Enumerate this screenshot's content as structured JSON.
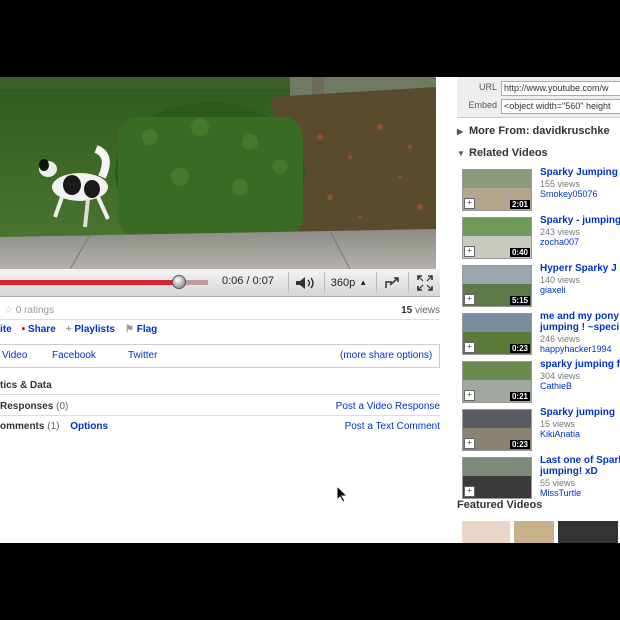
{
  "player": {
    "time": "0:06 / 0:07",
    "quality": "360p",
    "progress_fraction": 0.86,
    "buffered_fraction": 1.0
  },
  "info": {
    "ratings": "0 ratings",
    "views_count": "15",
    "views_label": "views"
  },
  "actions": {
    "favorite": "ite",
    "share": "Share",
    "playlists": "Playlists",
    "flag": "Flag"
  },
  "share_options": {
    "video": "Video",
    "facebook": "Facebook",
    "twitter": "Twitter",
    "more": "(more share options)"
  },
  "sections": {
    "stats": "tics & Data",
    "responses_label": "Responses",
    "responses_count": "(0)",
    "post_response": "Post a Video Response",
    "comments_label": "omments",
    "comments_count": "(1)",
    "options": "Options",
    "post_comment": "Post a Text Comment"
  },
  "embed": {
    "url_label": "URL",
    "url_value": "http://www.youtube.com/w",
    "embed_label": "Embed",
    "embed_value": "<object width=\"560\" height"
  },
  "sidebar": {
    "more_from": "More From: davidkruschke",
    "related_title": "Related Videos",
    "featured_title": "Featured Videos",
    "related": [
      {
        "title": "Sparky Jumping",
        "views": "155 views",
        "user": "Smokey05076",
        "duration": "2:01"
      },
      {
        "title": "Sparky - jumping",
        "views": "243 views",
        "user": "zocha007",
        "duration": "0:40"
      },
      {
        "title": "Hyperr Sparky J",
        "views": "140 views",
        "user": "giaxeli",
        "duration": "5:15"
      },
      {
        "title": "me and my pony",
        "title2": "jumping ! ~speci",
        "views": "246 views",
        "user": "happyhacker1994",
        "duration": "0:23"
      },
      {
        "title": "sparky jumping fr",
        "views": "304 views",
        "user": "CathieB",
        "duration": "0:21"
      },
      {
        "title": "Sparky jumping",
        "views": "15 views",
        "user": "KikiAnatia",
        "duration": "0:23"
      },
      {
        "title": "Last one of Spark",
        "title2": "jumping! xD",
        "views": "55 views",
        "user": "MissTurtle",
        "duration": ""
      }
    ]
  },
  "colors": {
    "link": "#0033cc",
    "progress": "#d8262b"
  }
}
